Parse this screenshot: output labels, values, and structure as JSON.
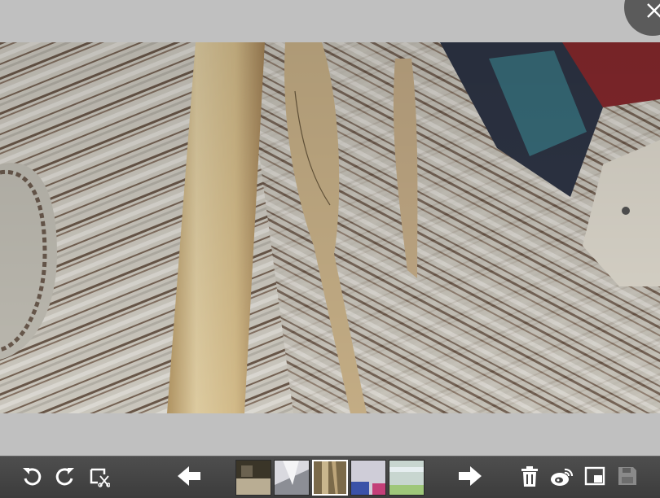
{
  "viewer": {
    "close_icon": "close-icon",
    "photo_description_icon": "photo"
  },
  "toolbar": {
    "buttons": [
      {
        "name": "rotate-left-button",
        "icon": "rotate-left-icon"
      },
      {
        "name": "rotate-right-button",
        "icon": "rotate-right-icon"
      },
      {
        "name": "crop-button",
        "icon": "crop-icon"
      },
      {
        "name": "previous-button",
        "icon": "arrow-left-icon"
      },
      {
        "name": "next-button",
        "icon": "arrow-right-icon"
      },
      {
        "name": "delete-button",
        "icon": "trash-icon"
      },
      {
        "name": "weibo-share-button",
        "icon": "weibo-icon"
      },
      {
        "name": "pip-button",
        "icon": "picture-in-picture-icon"
      },
      {
        "name": "save-button",
        "icon": "save-icon"
      }
    ],
    "thumbnails": [
      {
        "name": "thumbnail-1",
        "active": false,
        "colors": [
          "#3a3528",
          "#b9ad93"
        ]
      },
      {
        "name": "thumbnail-2",
        "active": false,
        "colors": [
          "#d9d9df",
          "#8c8e95"
        ]
      },
      {
        "name": "thumbnail-3",
        "active": true,
        "colors": [
          "#7b6a4a",
          "#c9b68d"
        ]
      },
      {
        "name": "thumbnail-4",
        "active": false,
        "colors": [
          "#cfcdd8",
          "#3a52a8"
        ]
      },
      {
        "name": "thumbnail-5",
        "active": false,
        "colors": [
          "#c8d6d0",
          "#9fc77a"
        ]
      }
    ]
  },
  "colors": {
    "background": "#c0c0c0",
    "toolbar": "#464646",
    "icon": "#ffffff",
    "save_disabled": "#8a8a8a"
  }
}
